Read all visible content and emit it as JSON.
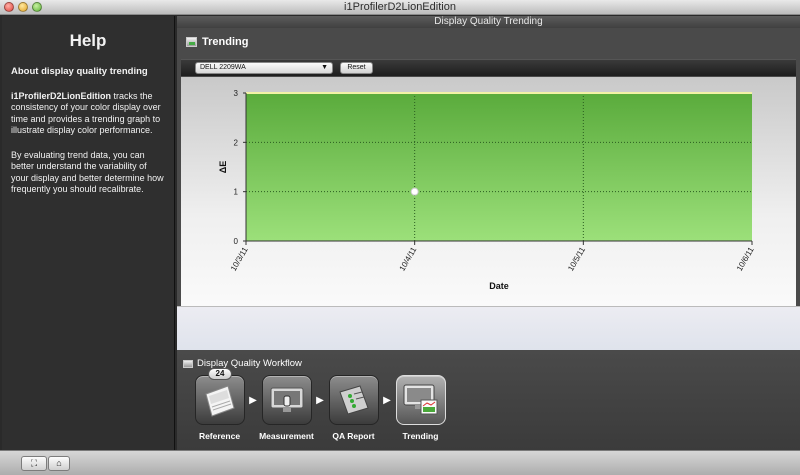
{
  "window": {
    "title": "i1ProfilerD2LionEdition"
  },
  "help": {
    "title": "Help",
    "subhead": "About display quality trending",
    "app_name": "i1ProfilerD2LionEdition",
    "para1_rest": " tracks the consistency of your color display over time and provides a trending graph to illustrate display color performance.",
    "para2": "By evaluating trend data, you can better understand the variability of your display and better determine how frequently you should recalibrate."
  },
  "main": {
    "header": "Display Quality Trending",
    "section_title": "Trending",
    "display_select": "DELL 2209WA",
    "reset_label": "Reset"
  },
  "chart_data": {
    "type": "area",
    "xlabel": "Date",
    "ylabel": "ΔE",
    "x_ticks": [
      "10/3/11",
      "10/4/11",
      "10/5/11",
      "10/6/11"
    ],
    "y_ticks": [
      0,
      1,
      2,
      3
    ],
    "ylim": [
      0,
      3
    ],
    "xlim": [
      "10/3/11",
      "10/6/11"
    ],
    "threshold": 3,
    "points": [
      {
        "x": "10/4/11",
        "y": 1
      }
    ],
    "grid": true,
    "colors": {
      "fill_top": "#5aab3c",
      "fill_bottom": "#9ce07a",
      "threshold_line": "#f2f2a6",
      "point": "#ffffff"
    }
  },
  "workflow": {
    "title": "Display Quality Workflow",
    "steps": [
      {
        "label": "Reference",
        "icon": "reference-document-icon",
        "badge": "24"
      },
      {
        "label": "Measurement",
        "icon": "monitor-measurement-icon"
      },
      {
        "label": "QA Report",
        "icon": "qa-report-icon"
      },
      {
        "label": "Trending",
        "icon": "trending-monitor-icon",
        "active": true
      }
    ]
  },
  "bottom": {
    "btn_fullscreen": "fullscreen-icon",
    "btn_home": "home-icon"
  }
}
